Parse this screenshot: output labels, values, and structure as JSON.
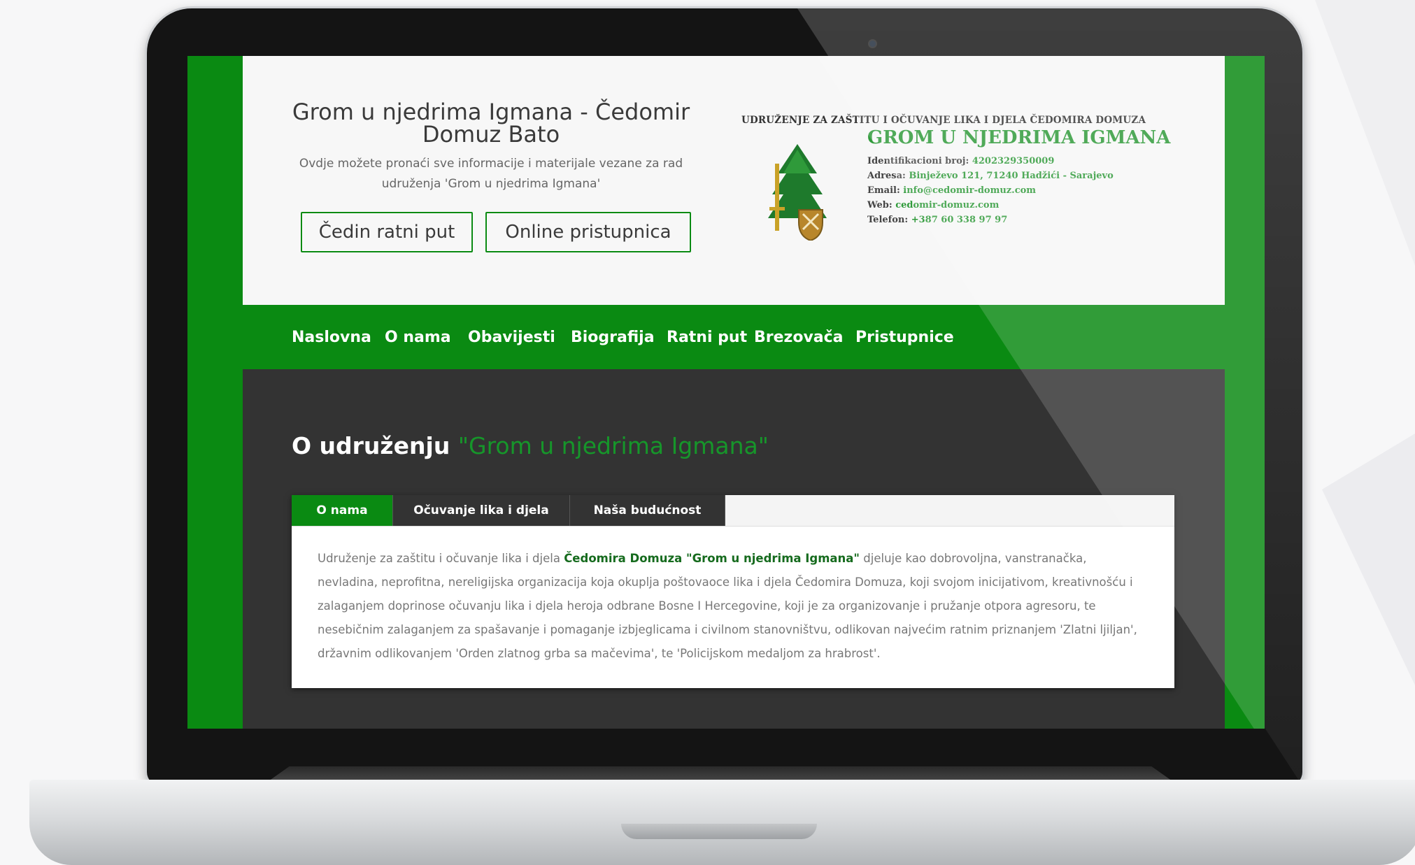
{
  "colors": {
    "accent": "#0a8a12",
    "dark": "#333333",
    "letterhead_green": "#2f9a3a"
  },
  "header": {
    "site_title": "Grom u njedrima Igmana - Čedomir Domuz Bato",
    "site_description": "Ovdje možete pronaći sve informacije i materijale vezane za rad udruženja 'Grom u njedrima Igmana'",
    "button_1": "Čedin ratni put",
    "button_2": "Online pristupnica"
  },
  "letterhead": {
    "top_line": "UDRUŽENJE ZA ZAŠTITU I OČUVANJE LIKA I DJELA ČEDOMIRA DOMUZA",
    "name": "GROM U NJEDRIMA IGMANA",
    "details": [
      {
        "label": "Identifikacioni broj:",
        "value": "4202329350009"
      },
      {
        "label": "Adresa:",
        "value": "Binježevo 121, 71240 Hadžići - Sarajevo"
      },
      {
        "label": "Email:",
        "value": "info@cedomir-domuz.com"
      },
      {
        "label": "Web:",
        "value": "cedomir-domuz.com"
      },
      {
        "label": "Telefon:",
        "value": "+387 60 338 97 97"
      }
    ],
    "logo_icon": "pine-tree-sword-crest-icon"
  },
  "nav": {
    "items": [
      "Naslovna",
      "O nama",
      "Obavijesti",
      "Biografija",
      "Ratni put",
      "Brezovača",
      "Pristupnice"
    ]
  },
  "content": {
    "section_title_prefix": "O udruženju",
    "section_title_highlight": "\"Grom u njedrima Igmana\"",
    "tabs": [
      "O nama",
      "Očuvanje lika i djela",
      "Naša budućnost"
    ],
    "active_tab": "O nama",
    "body_start": "Udruženje za zaštitu i očuvanje lika i djela ",
    "body_highlight": "Čedomira Domuza \"Grom u njedrima Igmana\"",
    "body_rest": " djeluje kao dobrovoljna, vanstranačka, nevladina, neprofitna, nereligijska organizacija koja okuplja poštovaoce lika i djela Čedomira Domuza, koji svojom inicijativom, kreativnošću i zalaganjem doprinose očuvanju lika i djela heroja odbrane Bosne I Hercegovine, koji je za organizovanje i pružanje otpora agresoru, te nesebičnim zalaganjem za spašavanje i pomaganje izbjeglicama i civilnom stanovništvu, odlikovan najvećim ratnim priznanjem 'Zlatni ljiljan', državnim odlikovanjem 'Orden zlatnog grba sa mačevima', te 'Policijskom medaljom za hrabrost'."
  }
}
